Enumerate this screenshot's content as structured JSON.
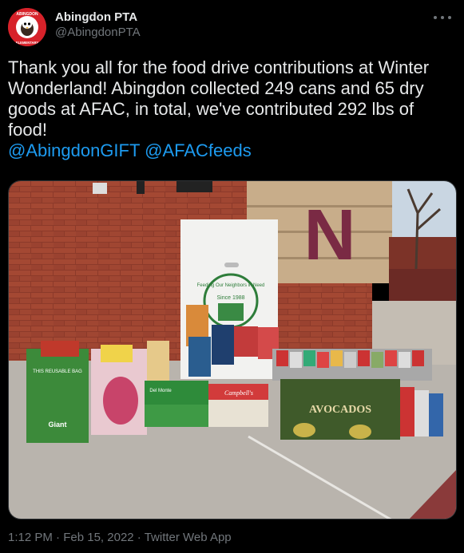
{
  "account": {
    "display_name": "Abingdon PTA",
    "handle": "@AbingdonPTA",
    "avatar_text_top": "ABINGDON",
    "avatar_text_bottom": "ELEMENTARY"
  },
  "tweet": {
    "text": "Thank you all for the food drive contributions at Winter Wonderland! Abingdon collected 249 cans and 65 dry goods at AFAC, in total, we've contributed 292 lbs of food!",
    "mentions": [
      "@AbingdonGIFT",
      "@AFACfeeds"
    ]
  },
  "photo": {
    "wall_letter": "N",
    "box_label": "Feeding Our Neighbors in Need",
    "box_since": "Since 1988",
    "crate_label": "AVOCADOS",
    "bag_text": "THIS REUSABLE BAG",
    "bag_brand": "Giant",
    "campbells": "Campbell's",
    "delmonte": "Del Monte"
  },
  "meta": {
    "time": "1:12 PM",
    "separator": " · ",
    "date": "Feb 15, 2022",
    "source": "Twitter Web App"
  }
}
